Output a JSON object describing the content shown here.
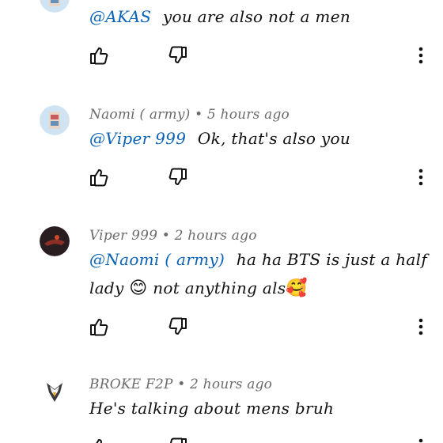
{
  "comments": [
    {
      "mention": "@AKAS",
      "text": "you are also not a men"
    },
    {
      "author": "Naomi ( army)",
      "time": "5 hours ago",
      "mention": "@Viper 999",
      "text": "Ok, that's also you"
    },
    {
      "author": "Viper 999",
      "time": "2 hours ago",
      "mention": "@Naomi ( army)",
      "text_line1": "ha ha  BTS is just a half",
      "text_line2_a": "lady",
      "emoji1": "😊",
      "text_line2_b": "not anything als",
      "emoji2": "🥰"
    },
    {
      "author": "BROKE F2P",
      "time": "2 hours ago",
      "text": "He's talking about mens bruh"
    }
  ],
  "separator": "•",
  "icons": {
    "like": "thumbs-up-icon",
    "dislike": "thumbs-down-icon",
    "more": "more-vertical-icon"
  },
  "colors": {
    "mention": "#0b63b6",
    "meta": "#6b6b6b",
    "text": "#111111"
  }
}
